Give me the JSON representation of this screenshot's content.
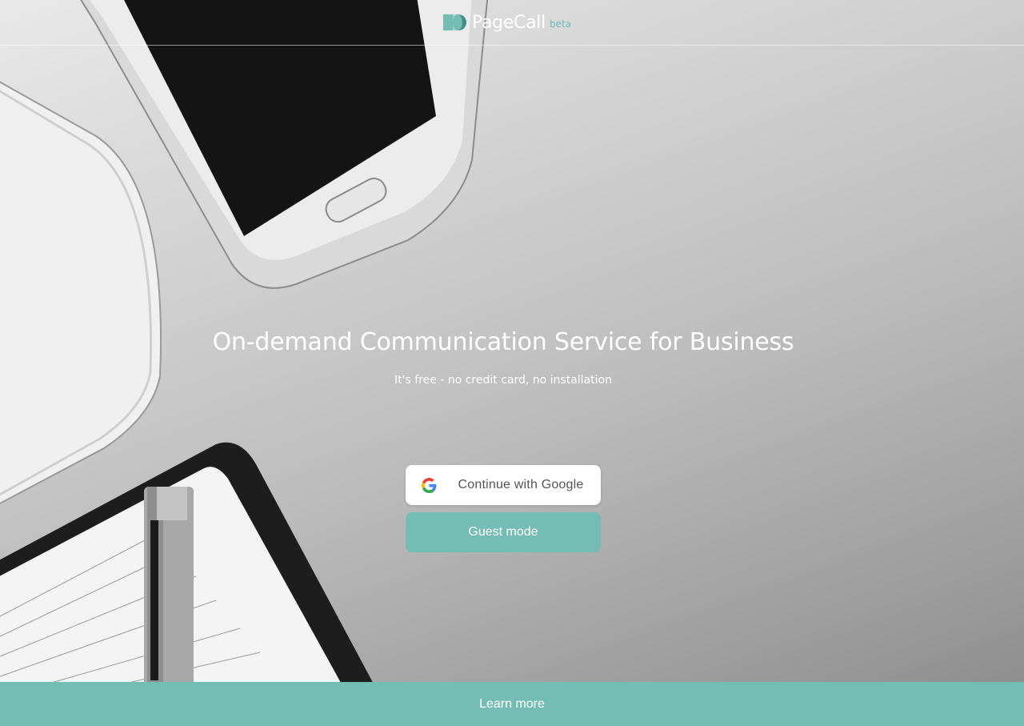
{
  "header": {
    "brand": "PageCall",
    "badge": "beta"
  },
  "hero": {
    "title": "On-demand Communication Service for Business",
    "subtitle": "It's free - no credit card, no installation"
  },
  "auth": {
    "google_label": "Continue with Google",
    "guest_label": "Guest mode"
  },
  "footer": {
    "learn_more_label": "Learn more"
  },
  "colors": {
    "accent": "#74bcb4",
    "white": "#ffffff"
  },
  "icons": [
    "pagecall-logo-icon",
    "google-icon"
  ]
}
